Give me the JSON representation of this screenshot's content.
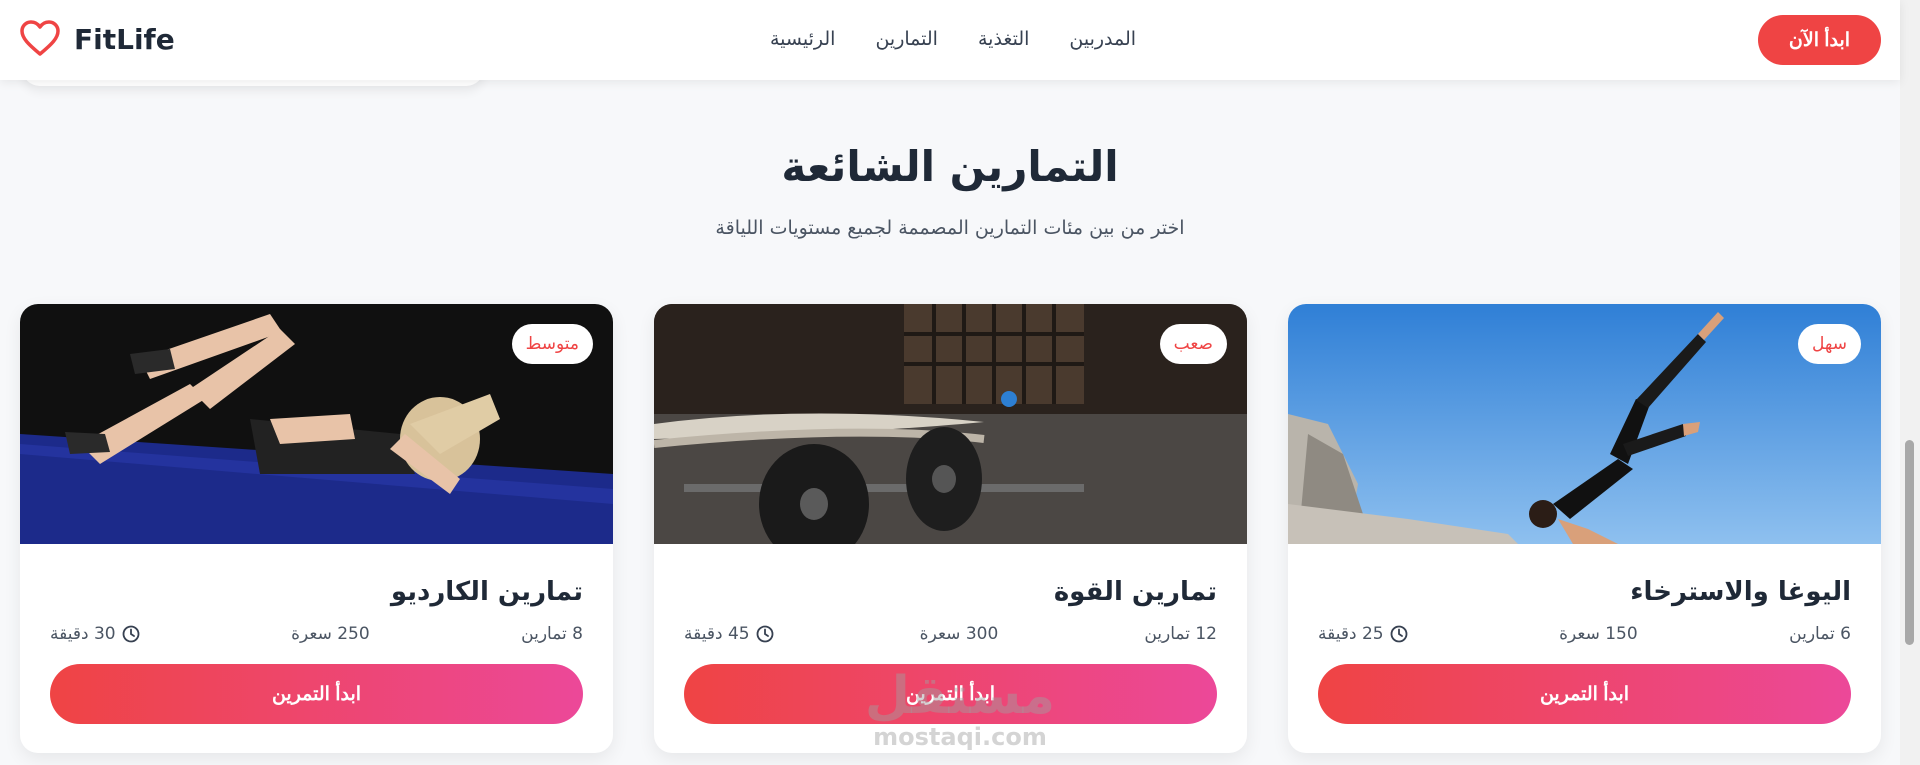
{
  "header": {
    "logo_text": "FitLife",
    "logo_icon": "heart-icon",
    "nav": [
      {
        "label": "الرئيسية"
      },
      {
        "label": "التمارين"
      },
      {
        "label": "التغذية"
      },
      {
        "label": "المدربين"
      }
    ],
    "cta_label": "ابدأ الآن"
  },
  "section": {
    "title": "التمارين الشائعة",
    "subtitle": "اختر من بين مئات التمارين المصممة لجميع مستويات اللياقة"
  },
  "cards": [
    {
      "title": "اليوغا والاسترخاء",
      "badge": "سهل",
      "exercises": "6 تمارين",
      "calories": "150 سعرة",
      "duration": "25 دقيقة",
      "button": "ابدأ التمرين",
      "image": "yoga-photo"
    },
    {
      "title": "تمارين القوة",
      "badge": "صعب",
      "exercises": "12 تمارين",
      "calories": "300 سعرة",
      "duration": "45 دقيقة",
      "button": "ابدأ التمرين",
      "image": "barbell-photo"
    },
    {
      "title": "تمارين الكارديو",
      "badge": "متوسط",
      "exercises": "8 تمارين",
      "calories": "250 سعرة",
      "duration": "30 دقيقة",
      "button": "ابدأ التمرين",
      "image": "cardio-photo"
    }
  ],
  "watermark": {
    "arabic": "مستقل",
    "latin": "mostaqi.com"
  },
  "colors": {
    "accent": "#ef4444",
    "accent_end": "#ec4899",
    "text": "#1f2937"
  }
}
